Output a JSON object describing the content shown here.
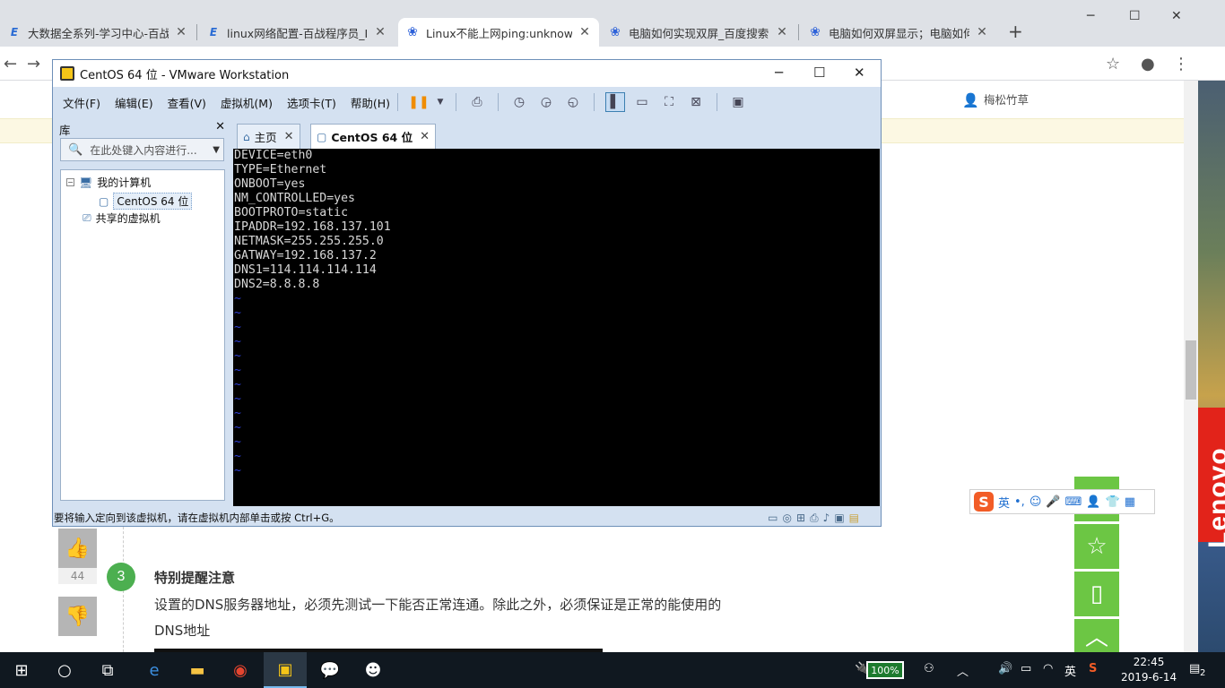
{
  "browser": {
    "tabs": [
      {
        "title": "大数据全系列-学习中心-百战程序员",
        "icon": "E"
      },
      {
        "title": "linux网络配置-百战程序员_IT在线教育",
        "icon": "E"
      },
      {
        "title": "Linux不能上网ping:unknown host",
        "icon": "paw"
      },
      {
        "title": "电脑如何实现双屏_百度搜索",
        "icon": "paw"
      },
      {
        "title": "电脑如何双屏显示；电脑如何",
        "icon": "paw"
      }
    ],
    "new_tab": "+",
    "win_min": "─",
    "win_max": "☐",
    "win_close": "✕"
  },
  "page": {
    "user_name": "梅松竹草",
    "like_count": "44",
    "step_number": "3",
    "step_title": "特别提醒注意",
    "step_body": "设置的DNS服务器地址，必须先测试一下能否正常连通。除此之外，必须保证是正常的能使用的DNS地址",
    "brand": "Lenovo"
  },
  "ime": {
    "logo": "S",
    "lang": "英",
    "punct": "•,"
  },
  "vmware": {
    "title": "CentOS 64 位 - VMware Workstation",
    "menu": [
      "文件(F)",
      "编辑(E)",
      "查看(V)",
      "虚拟机(M)",
      "选项卡(T)",
      "帮助(H)"
    ],
    "library": {
      "header": "库",
      "search_placeholder": "在此处键入内容进行...",
      "my_computer": "我的计算机",
      "vm_name": "CentOS 64 位",
      "shared": "共享的虚拟机"
    },
    "tabs": [
      {
        "label": "主页"
      },
      {
        "label": "CentOS 64 位"
      }
    ],
    "console_lines": [
      "DEVICE=eth0",
      "TYPE=Ethernet",
      "ONBOOT=yes",
      "NM_CONTROLLED=yes",
      "BOOTPROTO=static",
      "IPADDR=192.168.137.101",
      "NETMASK=255.255.255.0",
      "GATWAY=192.168.137.2",
      "DNS1=114.114.114.114",
      "DNS2=8.8.8.8"
    ],
    "status_text": "要将输入定向到该虚拟机，请在虚拟机内部单击或按 Ctrl+G。"
  },
  "taskbar": {
    "battery": "100%",
    "ime_lang": "英",
    "time": "22:45",
    "date": "2019-6-14",
    "notifications": "2"
  }
}
